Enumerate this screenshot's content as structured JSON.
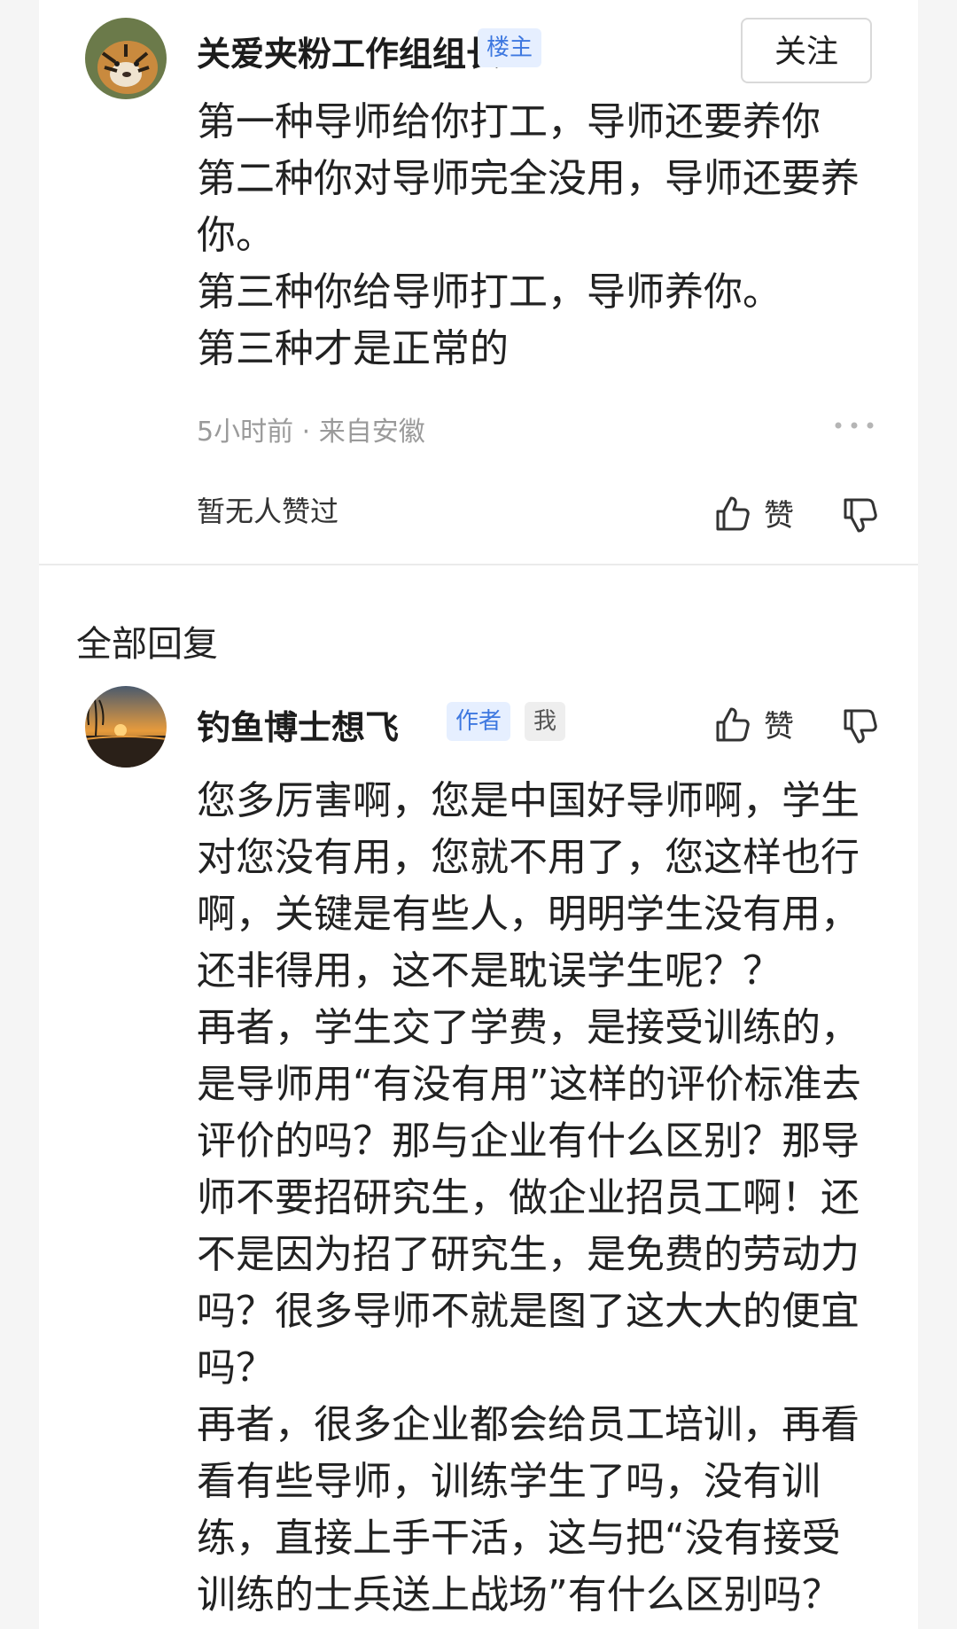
{
  "main_comment": {
    "username": "关爱夹粉工作组组长",
    "badge": "楼主",
    "follow_label": "关注",
    "lines": [
      "第一种导师给你打工，导师还要养你",
      "第二种你对导师完全没用，导师还要养你。",
      "第三种你给导师打工，导师养你。",
      "第三种才是正常的"
    ],
    "meta": "5小时前 · 来自安徽",
    "likes_note": "暂无人赞过",
    "like_label": "赞"
  },
  "replies_section": {
    "title": "全部回复"
  },
  "reply": {
    "username": "钓鱼博士想飞",
    "badge_author": "作者",
    "badge_me": "我",
    "like_label": "赞",
    "paragraphs": [
      "您多厉害啊，您是中国好导师啊，学生对您没有用，您就不用了，您这样也行啊，关键是有些人，明明学生没有用，还非得用，这不是耽误学生呢？？",
      "再者，学生交了学费，是接受训练的，是导师用“有没有用”这样的评价标准去评价的吗？那与企业有什么区别？那导师不要招研究生，做企业招员工啊！还不是因为招了研究生，是免费的劳动力吗？很多导师不就是图了这大大的便宜吗？",
      "再者，很多企业都会给员工培训，再看看有些导师，训练学生了吗，没有训练，直接上手干活，这与把“没有接受训练的士兵送上战场”有什么区别吗？"
    ]
  },
  "icons": {
    "thumbs_up": "thumbs-up-icon",
    "thumbs_down": "thumbs-down-icon",
    "more": "more-dots-icon"
  },
  "colors": {
    "badge_blue": "#3e78e0",
    "badge_bg": "#e6efff",
    "meta_gray": "#9a9a9a"
  }
}
